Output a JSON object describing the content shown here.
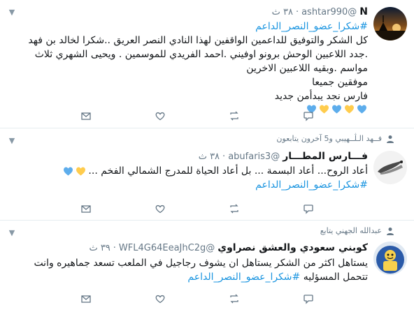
{
  "tweets": [
    {
      "id": "t1",
      "display_name": "N",
      "handle": "@ashtar990",
      "time": "٣٨ ث",
      "hashtag": "#شكرا_عضو_النصر_الداعم",
      "lines": [
        "كل الشكر والتوفيق للداعمين الواقفين لهذا النادي النصر العريق ..شكرا لخالد بن فهد",
        ".جدد اللاعبين الوحش برونو اوفيني .احمد الفريدي للموسمين . ويحيى الشهري ثلاث",
        "مواسم .وبقيه اللاعبين الاخرين",
        "موفقين جميعا",
        "فارس نجد يبدأمن جديد"
      ],
      "hearts": [
        "blue",
        "yellow",
        "blue",
        "yellow",
        "blue"
      ]
    },
    {
      "id": "t2",
      "context": "فــهد الـڷــهيبي و5 آخرون يتابعون",
      "display_name": "فـــارس المطـــار",
      "handle": "@abufaris3",
      "time": "٣٨ ث",
      "lines": [
        "أعاد الروح... أعاد البسمة ... بل أعاد الحياة للمدرج الشمالي الفخم ..."
      ],
      "hearts": [
        "yellow",
        "blue"
      ],
      "hashtag": "#شكرا_عضو_النصر_الداعم"
    },
    {
      "id": "t3",
      "context": "عبدالله الجهني يتابع",
      "display_name": "كوبني سعودي والعشق نصراوي",
      "handle": "@WFL4G64EeaJhC2g",
      "time": "٣٩ ث",
      "lines": [
        "يستاهل اكثر من الشكر يستاهل ان يشوف رجاجيل في الملعب تسعد جماهيره وانت",
        "تتحمل المسؤليه"
      ],
      "hashtag": "#شكرا_عضو_النصر_الداعم"
    }
  ],
  "colors": {
    "heart_blue": "#5dadec",
    "heart_yellow": "#ffcc4d",
    "link": "#1b95e0",
    "secondary": "#657786",
    "icon": "#657786"
  }
}
